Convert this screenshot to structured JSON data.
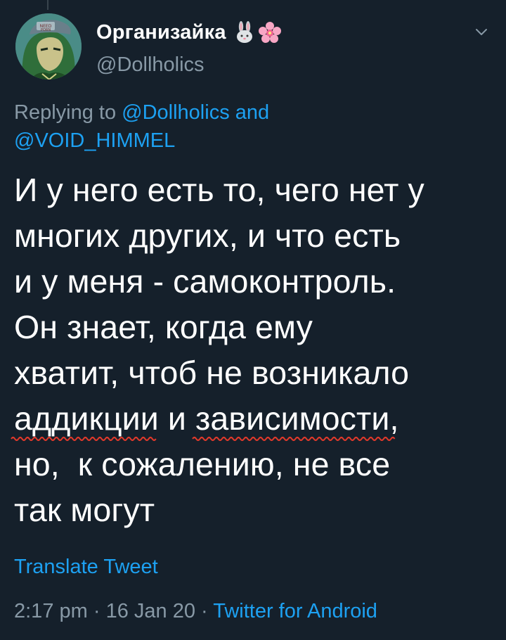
{
  "author": {
    "display_name": "Организайка",
    "handle": "@Dollholics",
    "emojis": [
      "rabbit-face-icon",
      "cherry-blossom-icon"
    ]
  },
  "reply": {
    "prefix": "Replying to",
    "mention_1": "@Dollholics",
    "connector": "and",
    "mention_2": "@VOID_HIMMEL"
  },
  "tweet": {
    "lines": [
      "И у него есть то, чего нет у",
      "многих других, и что есть",
      "и у меня - самоконтроль.",
      "Он знает, когда ему",
      "хватит, чтоб не возникало"
    ],
    "line6": {
      "word1": "аддикции",
      "middle": " и ",
      "word2": "зависимости",
      "tail": ","
    },
    "line7": "но,  к сожалению, не все",
    "line8": "так могут"
  },
  "translate_label": "Translate Tweet",
  "meta": {
    "time": "2:17 pm",
    "separator": " · ",
    "date": "16 Jan 20",
    "source": "Twitter for Android"
  },
  "colors": {
    "background": "#15202b",
    "text": "#ffffff",
    "secondary": "#8899a6",
    "link": "#1da1f2",
    "spellcheck": "#e0392b"
  }
}
